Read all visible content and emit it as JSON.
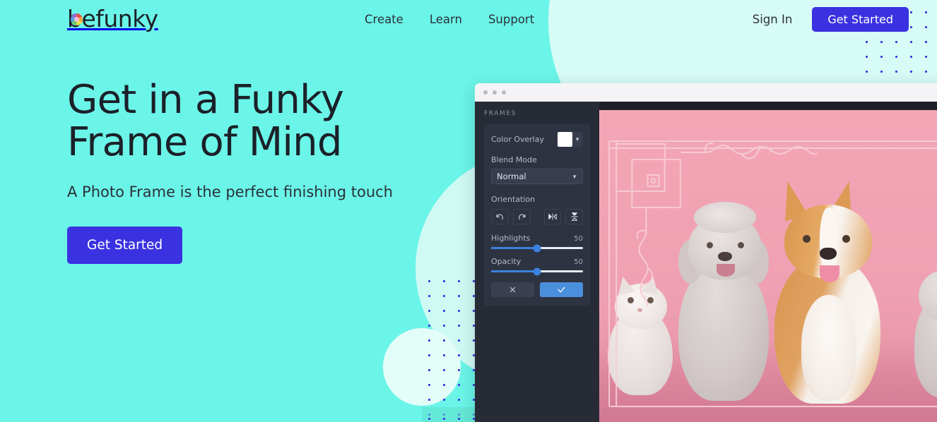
{
  "brand": {
    "logo_text": "befunky",
    "logo_icon": "aperture-icon"
  },
  "header": {
    "nav": [
      {
        "label": "Create"
      },
      {
        "label": "Learn"
      },
      {
        "label": "Support"
      }
    ],
    "sign_in_label": "Sign In",
    "get_started_label": "Get Started"
  },
  "hero": {
    "headline": "Get in a Funky\nFrame of Mind",
    "subhead": "A Photo Frame is the perfect finishing touch",
    "cta_label": "Get Started"
  },
  "editor": {
    "window_dots": [
      "dot",
      "dot",
      "dot"
    ],
    "panel_title": "FRAMES",
    "color_overlay": {
      "label": "Color Overlay",
      "swatch_color": "#ffffff",
      "chevron_icon": "chevron-down-icon"
    },
    "blend_mode": {
      "label": "Blend Mode",
      "value": "Normal",
      "chevron_icon": "chevron-down-icon"
    },
    "orientation": {
      "label": "Orientation",
      "buttons": [
        {
          "icon": "rotate-left-icon"
        },
        {
          "icon": "rotate-right-icon"
        },
        {
          "icon": "flip-horizontal-icon"
        },
        {
          "icon": "flip-vertical-icon"
        }
      ]
    },
    "sliders": [
      {
        "label": "Highlights",
        "value": "50",
        "percent": 50
      },
      {
        "label": "Opacity",
        "value": "50",
        "percent": 50
      }
    ],
    "actions": {
      "cancel_icon": "close-icon",
      "apply_icon": "check-icon"
    },
    "canvas": {
      "subject": "cat-poodle-corgi-photo",
      "frame_style": "ornate-swirl-frame"
    }
  },
  "colors": {
    "page_bg": "#6bf5e8",
    "accent_blue": "#3a32e0",
    "dot_blue": "#3a32e0",
    "pale_circle": "#d7fbf6",
    "panel_bg": "#272b36",
    "panel_card": "#2e3342",
    "slider_blue": "#3b82e0",
    "apply_blue": "#4a8fdb",
    "photo_pink": "#efa0b2",
    "text_dark": "#1b2029"
  }
}
